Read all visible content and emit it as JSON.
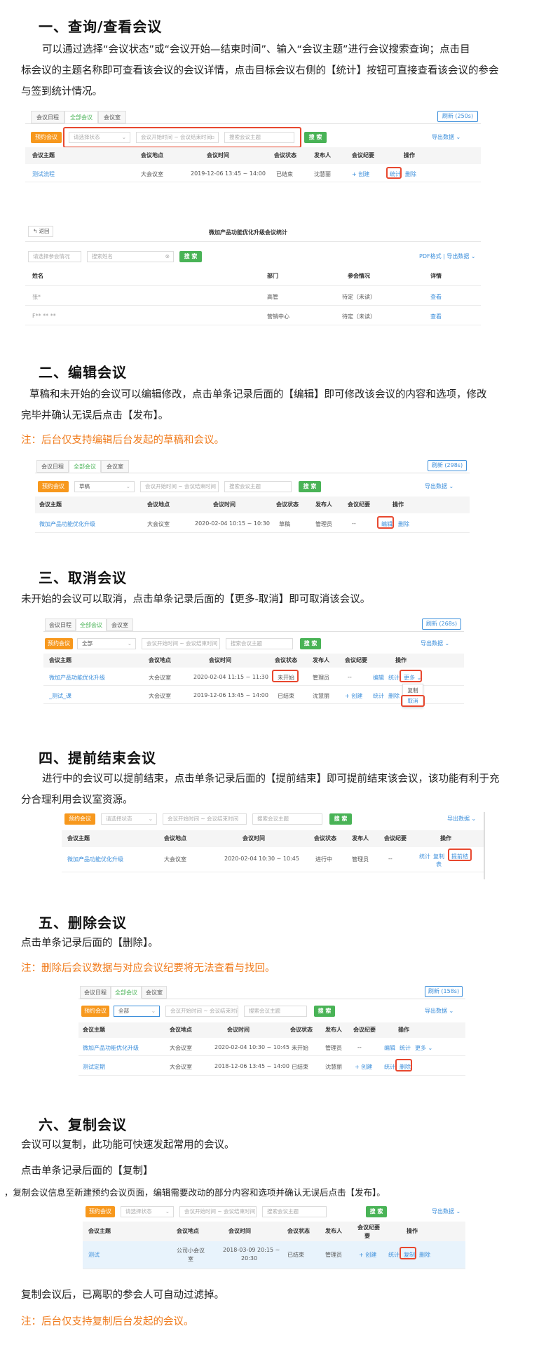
{
  "s1": {
    "heading": "一、查询/查看会议",
    "para_l1": "可以通过选择“会议状态”或“会议开始—结束时间”、输入“会议主题”进行会议搜索查询；点击目",
    "para_l2": "标会议的主题名称即可查看该会议的会议详情，点击目标会议右侧的【统计】按钮可直接查看该会议的参会",
    "para_l3": "与签到统计情况。",
    "shot": {
      "tabs": [
        "会议日程",
        "全部会议",
        "会议室"
      ],
      "refresh": "刷新 (250s)",
      "book": "预约会议",
      "status_ph": "请选择状态",
      "time_ph": "会议开始时间 ~ 会议结束时间",
      "topic_ph": "搜索会议主题",
      "search": "搜 索",
      "export": "导出数据 ⌄",
      "headers": [
        "会议主题",
        "会议地点",
        "会议时间",
        "会议状态",
        "发布人",
        "会议纪要",
        "操作"
      ],
      "row": {
        "topic": "测试流程",
        "place": "大会议室",
        "time": "2019-12-06 13:45 ~ 14:00",
        "status": "已结束",
        "publisher": "沈慧丽",
        "minutes": "+ 创建",
        "op1": "统计",
        "op2": "删除"
      }
    },
    "stats": {
      "back": "↰ 返回",
      "title": "微加产品功能优化升级会议统计",
      "attend_ph": "请选择参会情况",
      "name_ph": "搜索姓名",
      "search": "搜 索",
      "pdf": "PDF格式 | 导出数据 ⌄",
      "headers": [
        "姓名",
        "部门",
        "参会情况",
        "详情"
      ],
      "rows": [
        {
          "name": "张*",
          "dept": "高管",
          "state": "待定（未读）",
          "detail": "查看"
        },
        {
          "name": "F** ** **",
          "dept": "营销中心",
          "state": "待定（未读）",
          "detail": "查看"
        }
      ]
    }
  },
  "s2": {
    "heading": "二、编辑会议",
    "para_l1": "草稿和未开始的会议可以编辑修改，点击单条记录后面的【编辑】即可修改该会议的内容和选项，修改",
    "para_l2": "完毕并确认无误后点击【发布】。",
    "note": "注：后台仅支持编辑后台发起的草稿和会议。",
    "shot": {
      "tabs": [
        "会议日程",
        "全部会议",
        "会议室"
      ],
      "refresh": "刷新 (298s)",
      "book": "预约会议",
      "status_val": "草稿",
      "time_ph": "会议开始时间 ~ 会议结束时间",
      "topic_ph": "搜索会议主题",
      "search": "搜 索",
      "export": "导出数据 ⌄",
      "headers": [
        "会议主题",
        "会议地点",
        "会议时间",
        "会议状态",
        "发布人",
        "会议纪要",
        "操作"
      ],
      "row": {
        "topic": "微加产品功能优化升级",
        "place": "大会议室",
        "time": "2020-02-04 10:15 ~ 10:30",
        "status": "草稿",
        "publisher": "管理员",
        "minutes": "--",
        "op1": "编辑",
        "op2": "删除"
      }
    }
  },
  "s3": {
    "heading": "三、取消会议",
    "para_l1": "未开始的会议可以取消，点击单条记录后面的【更多-取消】即可取消该会议。",
    "shot": {
      "tabs": [
        "会议日程",
        "全部会议",
        "会议室"
      ],
      "refresh": "刷新 (268s)",
      "book": "预约会议",
      "status_val": "全部",
      "time_ph": "会议开始时间 ~ 会议结束时间",
      "topic_ph": "搜索会议主题",
      "search": "搜 索",
      "export": "导出数据 ⌄",
      "headers": [
        "会议主题",
        "会议地点",
        "会议时间",
        "会议状态",
        "发布人",
        "会议纪要",
        "操作"
      ],
      "rows": [
        {
          "topic": "微加产品功能优化升级",
          "place": "大会议室",
          "time": "2020-02-04 11:15 ~ 11:30",
          "status": "未开始",
          "publisher": "管理员",
          "minutes": "--",
          "ops": [
            "编辑",
            "统计",
            "更多 ⌄"
          ]
        },
        {
          "topic": "_测试_课",
          "place": "大会议室",
          "time": "2019-12-06 13:45 ~ 14:00",
          "status": "已结束",
          "publisher": "沈慧丽",
          "minutes": "+ 创建",
          "ops": [
            "统计",
            "删除"
          ]
        }
      ],
      "menu": [
        "复制",
        "取消"
      ]
    }
  },
  "s4": {
    "heading": "四、提前结束会议",
    "para_l1": "进行中的会议可以提前结束，点击单条记录后面的【提前结束】即可提前结束该会议，该功能有利于充",
    "para_l2": "分合理利用会议室资源。",
    "shot": {
      "book": "预约会议",
      "status_ph": "请选择状态",
      "time_ph": "会议开始时间 ~ 会议结束时间",
      "topic_ph": "搜索会议主题",
      "search": "搜 索",
      "export": "导出数据 ⌄",
      "headers": [
        "会议主题",
        "会议地点",
        "会议时间",
        "会议状态",
        "发布人",
        "会议纪要",
        "操作"
      ],
      "row": {
        "topic": "微加产品功能优化升级",
        "place": "大会议室",
        "time": "2020-02-04 10:30 ~ 10:45",
        "status": "进行中",
        "publisher": "管理员",
        "minutes": "--",
        "op1": "统计",
        "op2": "复制",
        "op2b": "表",
        "op3": "提前结"
      }
    }
  },
  "s5": {
    "heading": "五、删除会议",
    "para_l1": "点击单条记录后面的【删除】。",
    "note": "注：删除后会议数据与对应会议纪要将无法查看与找回。",
    "shot": {
      "tabs": [
        "会议日程",
        "全部会议",
        "会议室"
      ],
      "refresh": "刷新 (158s)",
      "book": "预约会议",
      "status_val": "全部",
      "time_ph": "会议开始时间 ~ 会议结束时间",
      "topic_ph": "搜索会议主题",
      "search": "搜 索",
      "export": "导出数据 ⌄",
      "headers": [
        "会议主题",
        "会议地点",
        "会议时间",
        "会议状态",
        "发布人",
        "会议纪要",
        "操作"
      ],
      "rows": [
        {
          "topic": "微加产品功能优化升级",
          "place": "大会议室",
          "time": "2020-02-04 10:30 ~ 10:45",
          "status": "未开始",
          "publisher": "管理员",
          "minutes": "--",
          "ops": [
            "编辑",
            "统计",
            "更多 ⌄"
          ]
        },
        {
          "topic": "测试定期",
          "place": "大会议室",
          "time": "2018-12-06 13:45 ~ 14:00",
          "status": "已结束",
          "publisher": "沈慧丽",
          "minutes": "+ 创建",
          "ops": [
            "统计",
            "删除"
          ]
        }
      ]
    }
  },
  "s6": {
    "heading": "六、复制会议",
    "para_l1": "会议可以复制，此功能可快速发起常用的会议。",
    "para_l2": "点击单条记录后面的【复制】",
    "para_l3": "，复制会议信息至新建预约会议页面，编辑需要改动的部分内容和选项并确认无误后点击【发布】。",
    "para_l4": "复制会议后，已离职的参会人可自动过滤掉。",
    "note": "注：后台仅支持复制后台发起的会议。",
    "shot": {
      "book": "预约会议",
      "status_ph": "请选择状态",
      "time_ph": "会议开始时间 ~ 会议结束时间",
      "topic_ph": "搜索会议主题",
      "search": "搜 索",
      "export": "导出数据 ⌄",
      "headers": [
        "会议主题",
        "会议地点",
        "会议时间",
        "会议状态",
        "发布人",
        "会议纪要",
        "操作"
      ],
      "headers_b": [
        "要"
      ],
      "row": {
        "topic": "测试",
        "place": "公司小会议",
        "place_b": "室",
        "time": "2018-03-09 20:15 ~",
        "time_b": "20:30",
        "status": "已结束",
        "publisher": "管理员",
        "minutes": "+ 创建",
        "op1": "统计",
        "op2": "复制",
        "op3": "删除"
      }
    }
  }
}
